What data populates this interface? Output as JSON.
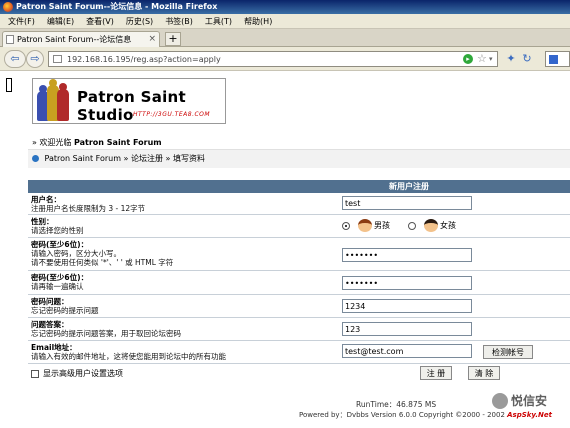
{
  "window": {
    "title": "Patron Saint Forum--论坛信息 - Mozilla Firefox"
  },
  "menu": [
    "文件(F)",
    "编辑(E)",
    "查看(V)",
    "历史(S)",
    "书签(B)",
    "工具(T)",
    "帮助(H)"
  ],
  "tab": {
    "label": "Patron Saint Forum--论坛信息",
    "new_tab": "+"
  },
  "nav": {
    "url": "192.168.16.195/reg.asp?action=apply"
  },
  "logo": {
    "title": "Patron Saint Studio",
    "url": "HTTP://3GU.TEA8.COM"
  },
  "welcome": {
    "prefix": "» 欢迎光临",
    "forum": "Patron Saint Forum"
  },
  "breadcrumb": {
    "home": "Patron Saint Forum",
    "sep1": "»",
    "step1": "论坛注册",
    "sep2": "»",
    "step2": "填写资料"
  },
  "form": {
    "header": "新用户注册",
    "rows": {
      "username": {
        "title": "用户名：",
        "hint": "注册用户名长度限制为 3 - 12字节",
        "value": "test"
      },
      "gender": {
        "title": "性别：",
        "hint": "请选择您的性别",
        "male": "男孩",
        "female": "女孩",
        "selected": "male"
      },
      "password": {
        "title": "密码(至少6位)：",
        "hint1": "请输入密码，区分大小写。",
        "hint2": "请不要使用任何类似 '*'、' ' 或 HTML 字符",
        "value": "1234567"
      },
      "password2": {
        "title": "密码(至少6位)：",
        "hint": "请再输一遍确认",
        "value": "1234567"
      },
      "question": {
        "title": "密码问题：",
        "hint": "忘记密码的提示问题",
        "value": "1234"
      },
      "answer": {
        "title": "问题答案：",
        "hint": "忘记密码的提示问题答案，用于取回论坛密码",
        "value": "123"
      },
      "email": {
        "title": "Email地址：",
        "hint": "请输入有效的邮件地址，这将使您能用到论坛中的所有功能",
        "value": "test@test.com",
        "check_button": "检测帐号"
      }
    },
    "advanced_label": "显示高级用户设置选项",
    "submit": "注 册",
    "reset": "清 除"
  },
  "footer": {
    "runtime": "RunTime：46.875 MS",
    "powered_prefix": "Powered by：Dvbbs Version 6.0.0  Copyright ©2000 - 2002",
    "powered_brand": "AspSky.Net"
  },
  "watermark": {
    "text": "悦信安"
  }
}
